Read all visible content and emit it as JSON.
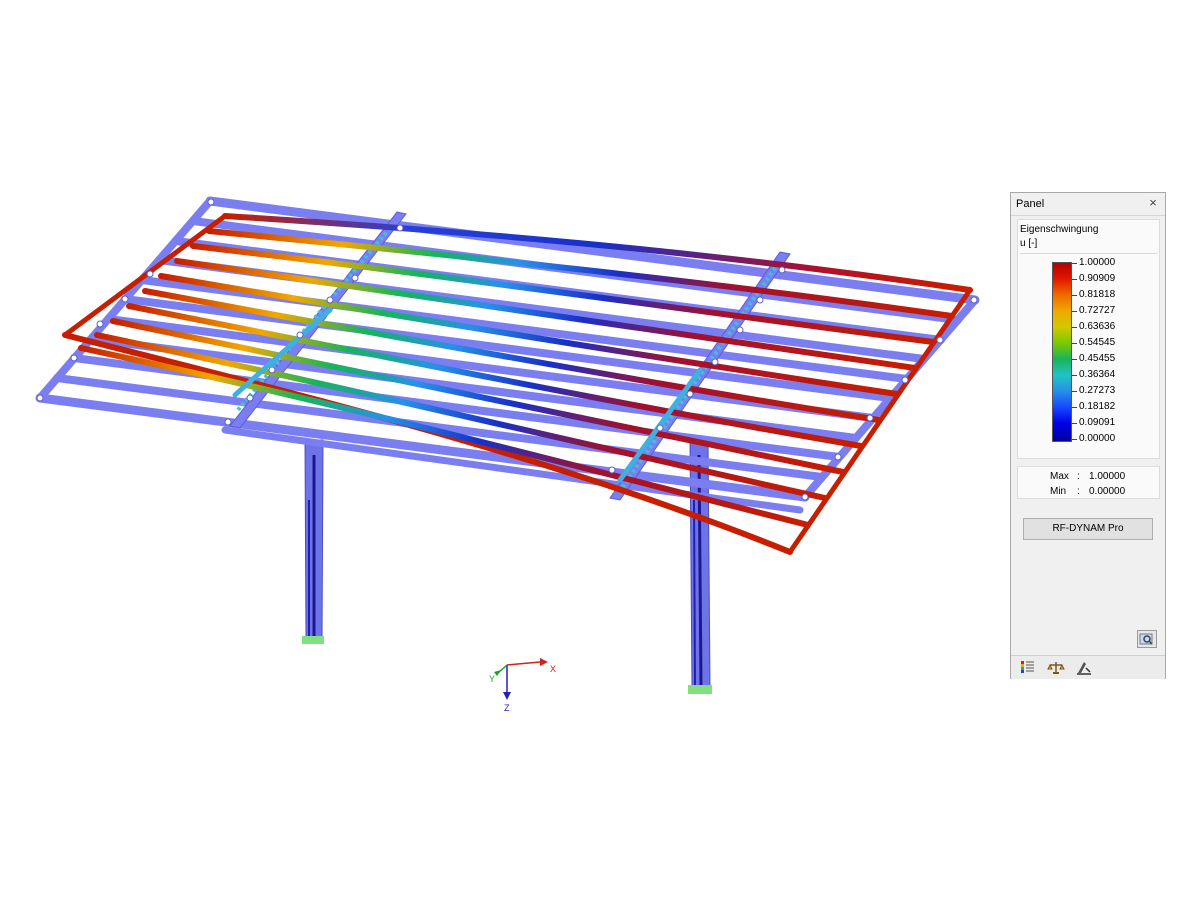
{
  "panel": {
    "title": "Panel",
    "close_symbol": "×",
    "result_type": "Eigenschwingung",
    "unit": "u [-]",
    "legend_values": [
      "1.00000",
      "0.90909",
      "0.81818",
      "0.72727",
      "0.63636",
      "0.54545",
      "0.45455",
      "0.36364",
      "0.27273",
      "0.18182",
      "0.09091",
      "0.00000"
    ],
    "max_label": "Max",
    "min_label": "Min",
    "separator": ":",
    "max_value": "1.00000",
    "min_value": "0.00000",
    "module_button": "RF-DYNAM Pro",
    "footer_icons": [
      "color-scale-icon",
      "balance-icon",
      "view-adjust-icon"
    ]
  },
  "axes": {
    "x": "X",
    "y": "Y",
    "z": "Z"
  },
  "colors": {
    "member_undeformed": "#7a7ef0",
    "member_max": "#c81e00",
    "support": "#80e080"
  }
}
